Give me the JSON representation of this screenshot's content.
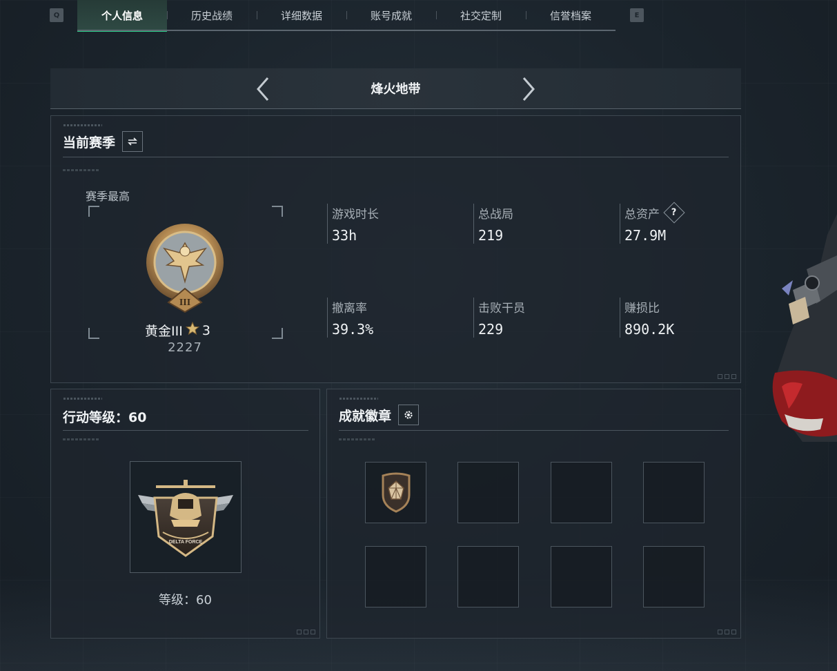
{
  "tabs": {
    "left_key": "Q",
    "right_key": "E",
    "items": [
      {
        "label": "个人信息",
        "active": true
      },
      {
        "label": "历史战绩",
        "active": false
      },
      {
        "label": "详细数据",
        "active": false
      },
      {
        "label": "账号成就",
        "active": false
      },
      {
        "label": "社交定制",
        "active": false
      },
      {
        "label": "信誉档案",
        "active": false
      }
    ]
  },
  "mode": {
    "title": "烽火地带"
  },
  "season": {
    "title": "当前赛季",
    "best_label": "赛季最高",
    "rank_name": "黄金III",
    "rank_stars": "3",
    "rank_score": "2227",
    "stats": [
      {
        "label": "游戏时长",
        "value": "33h"
      },
      {
        "label": "总战局",
        "value": "219"
      },
      {
        "label": "总资产",
        "value": "27.9M",
        "help": "?"
      },
      {
        "label": "撤离率",
        "value": "39.3%"
      },
      {
        "label": "击败干员",
        "value": "229"
      },
      {
        "label": "赚损比",
        "value": "890.2K"
      }
    ]
  },
  "level": {
    "title": "行动等级：60",
    "badge_text": "DELTA FORCE",
    "label": "等级：60"
  },
  "achievements": {
    "title": "成就徽章"
  },
  "colors": {
    "accent": "#2ccf8a",
    "gold": "#c9a46a",
    "background": "#1b242c"
  }
}
